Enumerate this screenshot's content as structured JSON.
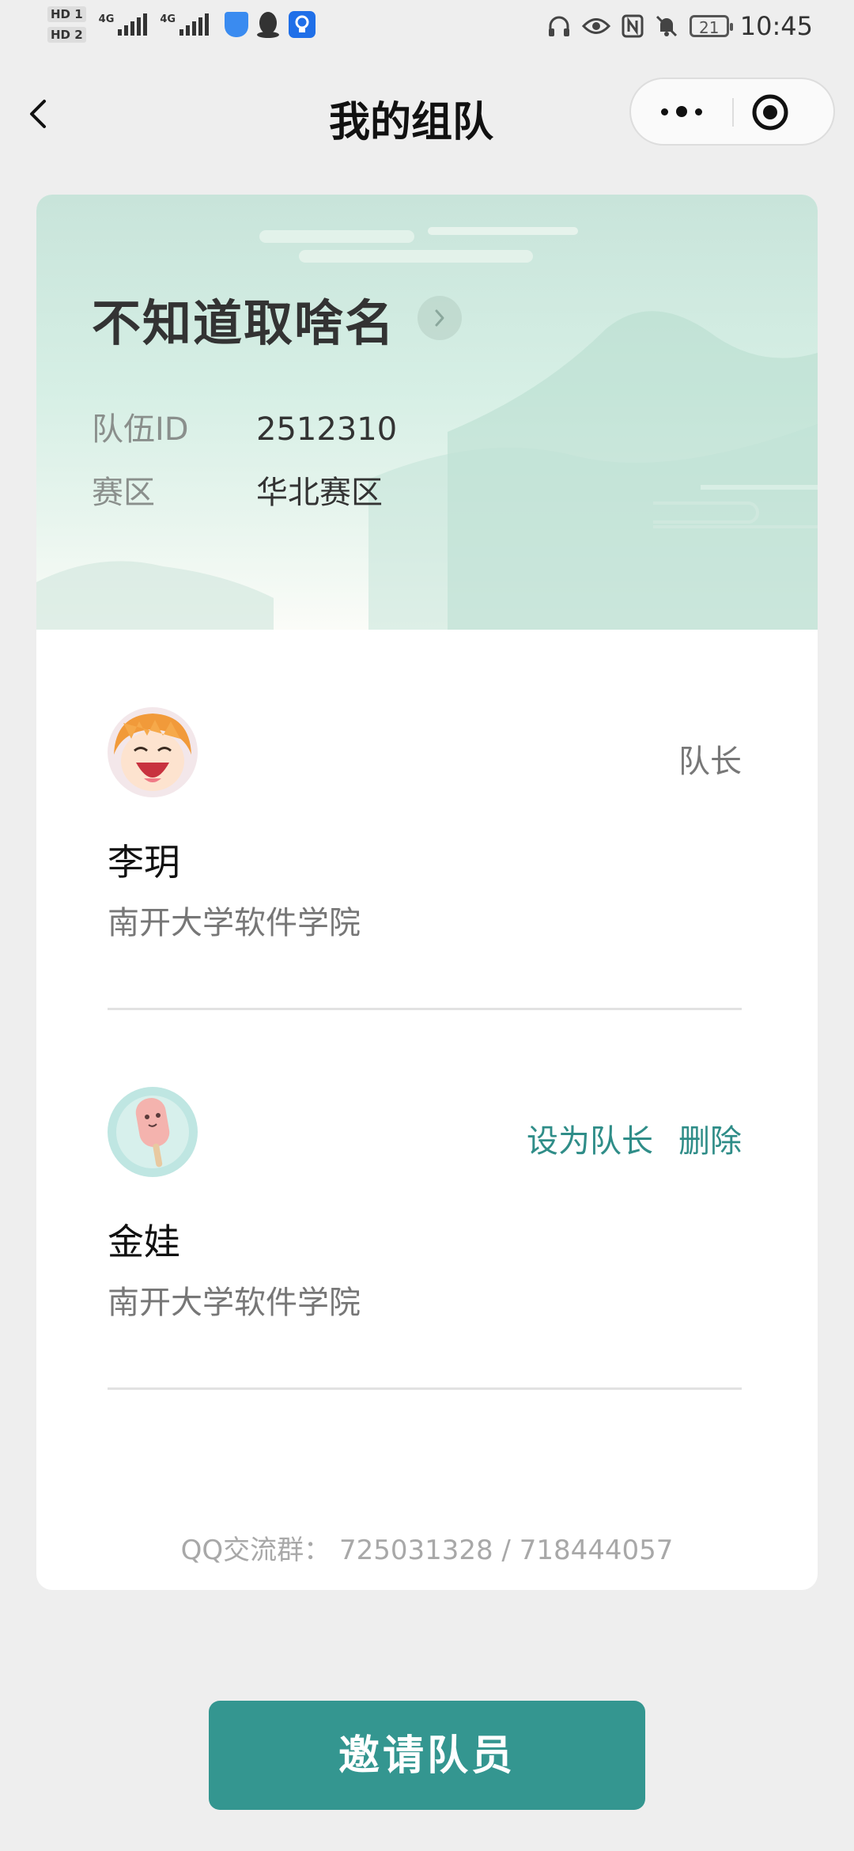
{
  "status_bar": {
    "sim1": "HD 1",
    "sim2": "HD 2",
    "net1": "4G",
    "net2": "4G",
    "battery": "21",
    "time": "10:45"
  },
  "nav": {
    "title": "我的组队"
  },
  "team": {
    "name": "不知道取啥名",
    "id_label": "队伍ID",
    "id_value": "2512310",
    "region_label": "赛区",
    "region_value": "华北赛区"
  },
  "members": [
    {
      "name": "李玥",
      "school": "南开大学软件学院",
      "role": "队长",
      "avatar": "cartoon-face-avatar"
    },
    {
      "name": "金娃",
      "school": "南开大学软件学院",
      "actions": [
        "设为队长",
        "删除"
      ],
      "avatar": "popsicle-avatar"
    }
  ],
  "footer": {
    "qq_group": "QQ交流群：  725031328 / 718444057"
  },
  "invite_button": "邀请队员",
  "colors": {
    "accent": "#349690",
    "action_text": "#2f8d88"
  }
}
